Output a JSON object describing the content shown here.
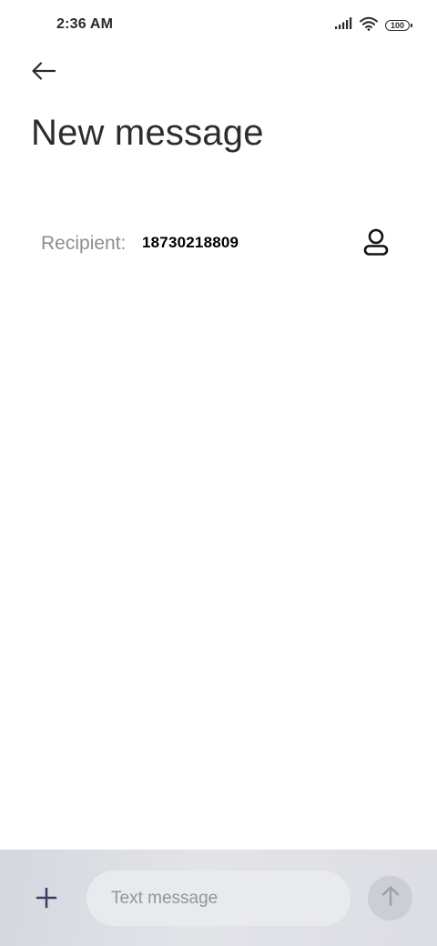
{
  "status_bar": {
    "time": "2:36 AM",
    "battery_level": "100",
    "icons": [
      "signal-icon",
      "wifi-icon",
      "battery-icon"
    ]
  },
  "header": {
    "back_icon": "back-arrow-icon",
    "title": "New message"
  },
  "recipient": {
    "label": "Recipient:",
    "value": "18730218809",
    "contact_icon": "contact-person-icon"
  },
  "composer": {
    "add_icon": "plus-icon",
    "placeholder": "Text message",
    "value": "",
    "send_icon": "send-arrow-icon"
  },
  "colors": {
    "title": "#2c2c31",
    "label": "#8e8e93",
    "composer_bar": "#dcdde3",
    "input_background": "#e9eaee",
    "send_button_disabled": "#cbced5",
    "plus_icon": "#3b3f63"
  }
}
